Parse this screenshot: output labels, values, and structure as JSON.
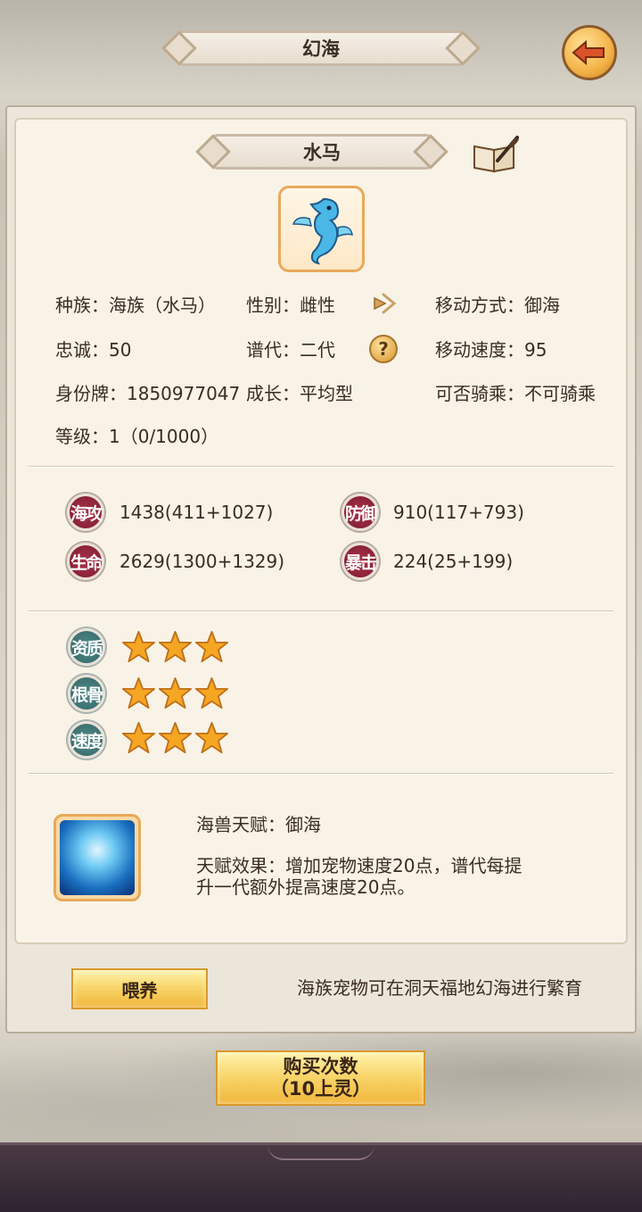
{
  "header": {
    "title": "幻海"
  },
  "pet": {
    "name": "水马",
    "info": {
      "race": "种族：海族（水马）",
      "gender": "性别：雌性",
      "move_mode": "移动方式：御海",
      "loyalty": "忠诚：50",
      "generation": "谱代：二代",
      "move_speed": "移动速度：95",
      "id_card": "身份牌：1850977047",
      "growth": "成长：平均型",
      "rideable": "可否骑乘：不可骑乘",
      "level": "等级：1（0/1000）"
    }
  },
  "stats": [
    {
      "badge": "海攻",
      "value": "1438(411+1027)"
    },
    {
      "badge": "防御",
      "value": "910(117+793)"
    },
    {
      "badge": "生命",
      "value": "2629(1300+1329)"
    },
    {
      "badge": "暴击",
      "value": "224(25+199)"
    }
  ],
  "aptitudes": [
    {
      "badge": "资质",
      "stars": 3
    },
    {
      "badge": "根骨",
      "stars": 3
    },
    {
      "badge": "速度",
      "stars": 3
    }
  ],
  "talent": {
    "name": "海兽天赋：御海",
    "effect_line1": "天赋效果：增加宠物速度20点，谱代每提",
    "effect_line2": "升一代额外提高速度20点。"
  },
  "actions": {
    "feed_label": "喂养",
    "breed_hint": "海族宠物可在洞天福地幻海进行繁育",
    "buy_label_line1": "购买次数",
    "buy_label_line2": "（10上灵）"
  },
  "colors": {
    "stat_badge": "#8b2238",
    "aptitude_badge": "#3d7271",
    "star": "#f5a623",
    "button_gold": "#f8d66b"
  },
  "icons": {
    "back": "back-arrow-icon",
    "book": "book-quill-icon",
    "arrow": "arrow-right-icon",
    "help": "help-icon"
  }
}
